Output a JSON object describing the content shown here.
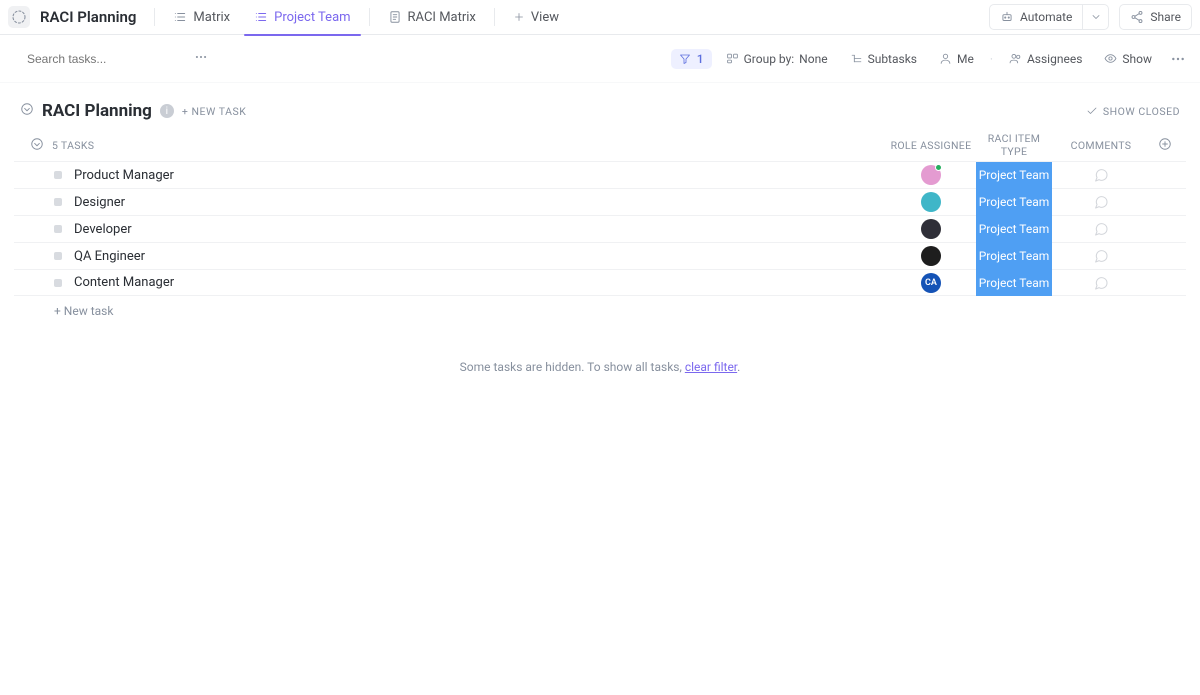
{
  "workspace": {
    "title": "RACI Planning"
  },
  "tabs": [
    {
      "name": "matrix",
      "label": "Matrix",
      "icon": "list"
    },
    {
      "name": "project-team",
      "label": "Project Team",
      "icon": "list",
      "active": true
    },
    {
      "name": "raci-matrix",
      "label": "RACI Matrix",
      "icon": "doc"
    }
  ],
  "addView": {
    "label": "View"
  },
  "topRight": {
    "automate": "Automate",
    "share": "Share"
  },
  "search": {
    "placeholder": "Search tasks..."
  },
  "toolbar": {
    "filterCount": "1",
    "groupByLabel": "Group by:",
    "groupByValue": "None",
    "subtasks": "Subtasks",
    "me": "Me",
    "assignees": "Assignees",
    "show": "Show"
  },
  "group": {
    "title": "RACI Planning",
    "newTask": "+ NEW TASK",
    "showClosed": "SHOW CLOSED",
    "taskCount": "5 TASKS",
    "newTaskRow": "+ New task"
  },
  "columns": {
    "assignee": "ROLE ASSIGNEE",
    "type": "RACI ITEM TYPE",
    "comments": "COMMENTS"
  },
  "tasks": [
    {
      "name": "Product Manager",
      "avatar": {
        "bg": "#e49bd1",
        "initials": "",
        "presence": true
      },
      "type": "Project Team"
    },
    {
      "name": "Designer",
      "avatar": {
        "bg": "#3fb6c8",
        "initials": "",
        "presence": false
      },
      "type": "Project Team"
    },
    {
      "name": "Developer",
      "avatar": {
        "bg": "#2f2f38",
        "initials": "",
        "presence": false
      },
      "type": "Project Team"
    },
    {
      "name": "QA Engineer",
      "avatar": {
        "bg": "#1e1e1e",
        "initials": "",
        "presence": false
      },
      "type": "Project Team"
    },
    {
      "name": "Content Manager",
      "avatar": {
        "bg": "#1553b6",
        "initials": "CA",
        "presence": false
      },
      "type": "Project Team"
    }
  ],
  "hiddenMsg": {
    "text": "Some tasks are hidden. To show all tasks, ",
    "link": "clear filter",
    "suffix": "."
  },
  "colors": {
    "accent": "#7b68ee",
    "chip": "#4f9ff3"
  }
}
